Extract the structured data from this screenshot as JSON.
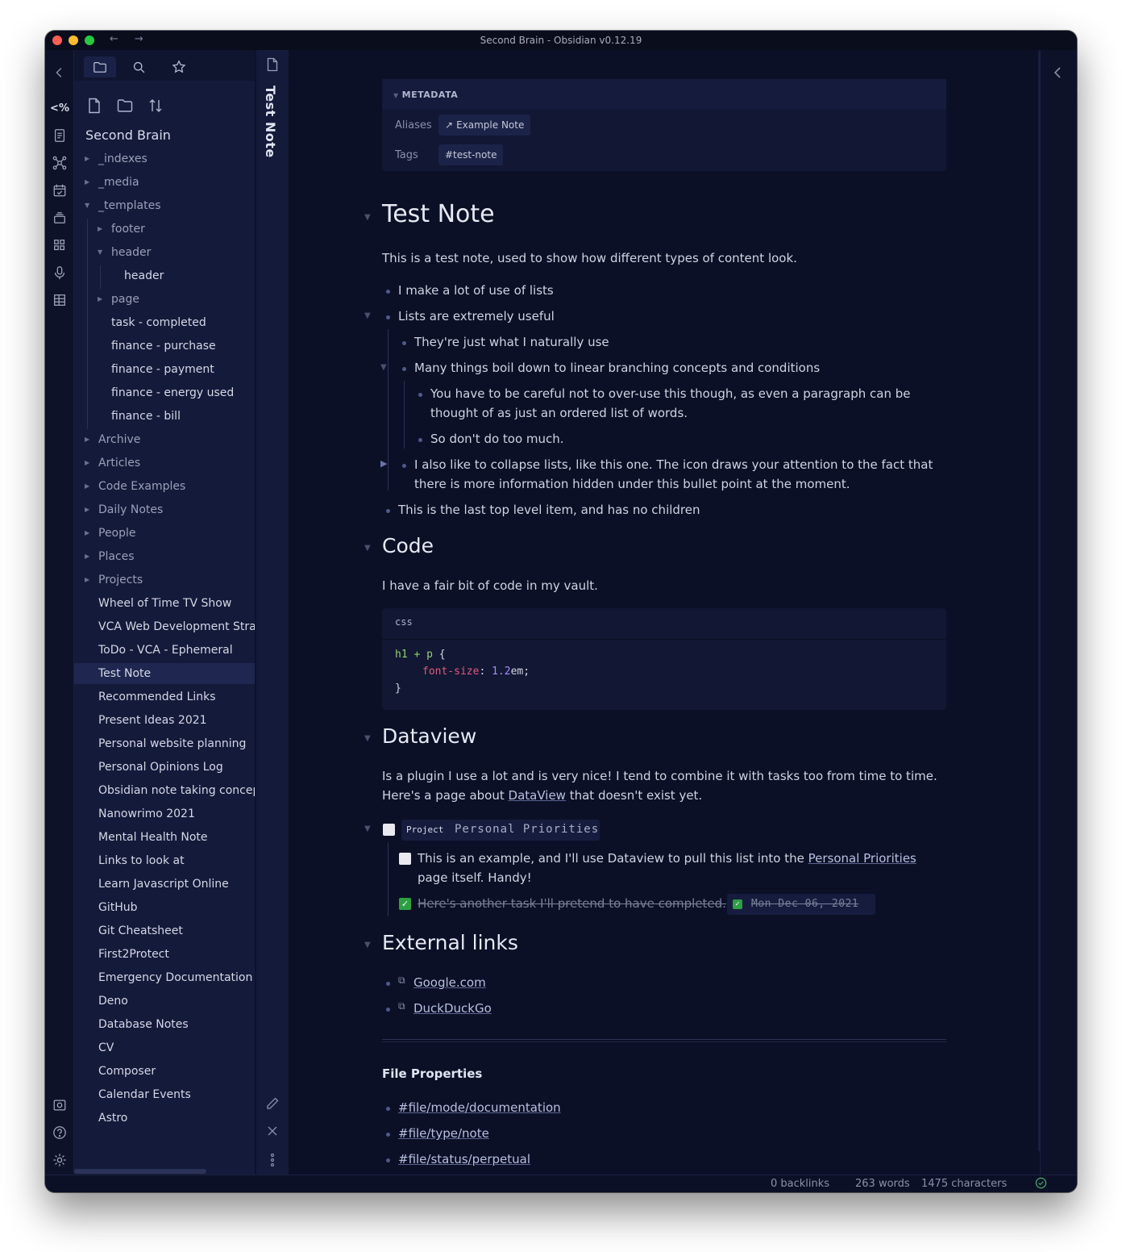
{
  "window": {
    "title": "Second Brain - Obsidian v0.12.19",
    "back": "←",
    "forward": "→"
  },
  "ribbon": {
    "icons": [
      "markdown-code-icon",
      "document-list-icon",
      "graph-icon",
      "calendar-check-icon",
      "stack-icon",
      "grid-icon",
      "microphone-icon",
      "table-icon",
      "vault-icon",
      "help-icon",
      "settings-icon"
    ],
    "code_label": "<%"
  },
  "sidebar": {
    "vault_name": "Second Brain",
    "tree": [
      {
        "label": "_indexes",
        "type": "folder",
        "depth": 0,
        "state": "closed"
      },
      {
        "label": "_media",
        "type": "folder",
        "depth": 0,
        "state": "closed"
      },
      {
        "label": "_templates",
        "type": "folder",
        "depth": 0,
        "state": "open"
      },
      {
        "label": "footer",
        "type": "folder",
        "depth": 1,
        "state": "closed"
      },
      {
        "label": "header",
        "type": "folder",
        "depth": 1,
        "state": "open"
      },
      {
        "label": "header",
        "type": "file",
        "depth": 2
      },
      {
        "label": "page",
        "type": "folder",
        "depth": 1,
        "state": "closed"
      },
      {
        "label": "task - completed",
        "type": "file",
        "depth": 1
      },
      {
        "label": "finance - purchase",
        "type": "file",
        "depth": 1
      },
      {
        "label": "finance - payment",
        "type": "file",
        "depth": 1
      },
      {
        "label": "finance - energy used",
        "type": "file",
        "depth": 1
      },
      {
        "label": "finance - bill",
        "type": "file",
        "depth": 1
      },
      {
        "label": "Archive",
        "type": "folder",
        "depth": 0,
        "state": "closed"
      },
      {
        "label": "Articles",
        "type": "folder",
        "depth": 0,
        "state": "closed"
      },
      {
        "label": "Code Examples",
        "type": "folder",
        "depth": 0,
        "state": "closed"
      },
      {
        "label": "Daily Notes",
        "type": "folder",
        "depth": 0,
        "state": "closed"
      },
      {
        "label": "People",
        "type": "folder",
        "depth": 0,
        "state": "closed"
      },
      {
        "label": "Places",
        "type": "folder",
        "depth": 0,
        "state": "closed"
      },
      {
        "label": "Projects",
        "type": "folder",
        "depth": 0,
        "state": "closed"
      },
      {
        "label": "Wheel of Time TV Show",
        "type": "file",
        "depth": 0
      },
      {
        "label": "VCA Web Development Strat",
        "type": "file",
        "depth": 0
      },
      {
        "label": "ToDo - VCA - Ephemeral",
        "type": "file",
        "depth": 0
      },
      {
        "label": "Test Note",
        "type": "file",
        "depth": 0,
        "active": true
      },
      {
        "label": "Recommended Links",
        "type": "file",
        "depth": 0
      },
      {
        "label": "Present Ideas 2021",
        "type": "file",
        "depth": 0
      },
      {
        "label": "Personal website planning",
        "type": "file",
        "depth": 0
      },
      {
        "label": "Personal Opinions Log",
        "type": "file",
        "depth": 0
      },
      {
        "label": "Obsidian note taking concept",
        "type": "file",
        "depth": 0
      },
      {
        "label": "Nanowrimo 2021",
        "type": "file",
        "depth": 0
      },
      {
        "label": "Mental Health Note",
        "type": "file",
        "depth": 0
      },
      {
        "label": "Links to look at",
        "type": "file",
        "depth": 0
      },
      {
        "label": "Learn Javascript Online",
        "type": "file",
        "depth": 0
      },
      {
        "label": "GitHub",
        "type": "file",
        "depth": 0
      },
      {
        "label": "Git Cheatsheet",
        "type": "file",
        "depth": 0
      },
      {
        "label": "First2Protect",
        "type": "file",
        "depth": 0
      },
      {
        "label": "Emergency Documentation",
        "type": "file",
        "depth": 0
      },
      {
        "label": "Deno",
        "type": "file",
        "depth": 0
      },
      {
        "label": "Database Notes",
        "type": "file",
        "depth": 0
      },
      {
        "label": "CV",
        "type": "file",
        "depth": 0
      },
      {
        "label": "Composer",
        "type": "file",
        "depth": 0
      },
      {
        "label": "Calendar Events",
        "type": "file",
        "depth": 0
      },
      {
        "label": "Astro",
        "type": "file",
        "depth": 0
      }
    ]
  },
  "pane": {
    "vertical_title": "Test Note"
  },
  "note": {
    "metadata": {
      "heading": "METADATA",
      "aliases_label": "Aliases",
      "aliases_value": "Example Note",
      "tags_label": "Tags",
      "tags_value": "#test-note"
    },
    "title": "Test Note",
    "intro": "This is a test note, used to show how different types of content look.",
    "list": {
      "item1": "I make a lot of use of lists",
      "item2": "Lists are extremely useful",
      "item2a": "They're just what I naturally use",
      "item2b": "Many things boil down to linear branching concepts and conditions",
      "item2b1_line1": "You have to be careful not to over-use this though, as even a paragraph can be",
      "item2b1_line2": "thought of as just an ordered list of words.",
      "item2b2": "So don't do too much.",
      "item2c_line1": "I also like to collapse lists, like this one. The icon draws your attention to the fact that",
      "item2c_line2": "there is more information hidden under this bullet point at the moment.",
      "item3": "This is the last top level item, and has no children"
    },
    "code": {
      "heading": "Code",
      "intro": "I have a fair bit of code in my vault.",
      "lang": "css",
      "selector": "h1 + p",
      "open_brace": " {",
      "prop": "font-size",
      "colon": ": ",
      "num": "1.2",
      "unit": "em;",
      "close_brace": "}"
    },
    "dataview": {
      "heading": "Dataview",
      "line1": "Is a plugin I use a lot and is very nice! I tend to combine it with tasks too from time to time.",
      "line2_prefix": "Here's a page about ",
      "line2_link": "DataView",
      "line2_suffix": " that doesn't exist yet.",
      "project_tag": "Project",
      "project_name": "Personal Priorities",
      "task1_line1_prefix": "This is an example, and I'll use Dataview to pull this list into the ",
      "task1_link": "Personal Priorities",
      "task1_line2": "page itself. Handy!",
      "task2": "Here's another task I'll pretend to have completed.",
      "task2_check": "✓",
      "task2_date": "Mon Dec 06, 2021"
    },
    "external": {
      "heading": "External links",
      "link1": "Google.com",
      "link2": "DuckDuckGo"
    },
    "file_props": {
      "heading": "File Properties",
      "tag1": "#file/mode/documentation",
      "tag2": "#file/type/note",
      "tag3": "#file/status/perpetual"
    }
  },
  "status": {
    "backlinks": "0 backlinks",
    "words": "263 words",
    "characters": "1475 characters"
  }
}
